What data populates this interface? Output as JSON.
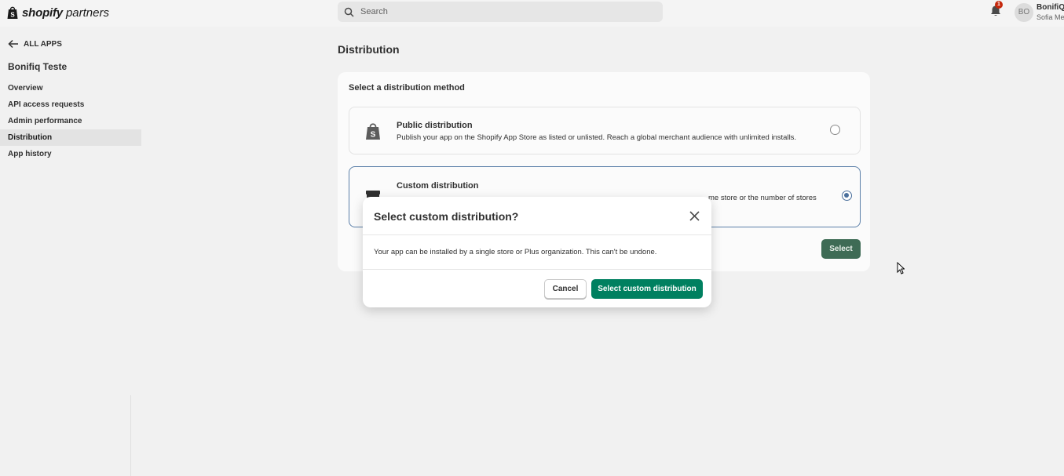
{
  "topbar": {
    "brand": "shopify",
    "brand_sub": "partners",
    "search_placeholder": "Search",
    "notification_count": "1",
    "avatar_initials": "BO",
    "user_name": "BonifiQ",
    "user_sub": "Sofia Mel"
  },
  "sidebar": {
    "back_label": "ALL APPS",
    "app_name": "Bonifiq Teste",
    "items": [
      {
        "label": "Overview"
      },
      {
        "label": "API access requests"
      },
      {
        "label": "Admin performance"
      },
      {
        "label": "Distribution"
      },
      {
        "label": "App history"
      }
    ]
  },
  "main": {
    "title": "Distribution",
    "card_heading": "Select a distribution method",
    "options": [
      {
        "title": "Public distribution",
        "description": "Publish your app on the Shopify App Store as listed or unlisted. Reach a global merchant audience with unlimited installs."
      },
      {
        "title": "Custom distribution",
        "description": "me store or the number of stores"
      }
    ],
    "select_label": "Select"
  },
  "modal": {
    "title": "Select custom distribution?",
    "body": "Your app can be installed by a single store or Plus organization. This can't be undone.",
    "cancel_label": "Cancel",
    "confirm_label": "Select custom distribution"
  },
  "colors": {
    "primary_green": "#008060",
    "selected_border": "#5b7fa8",
    "badge_red": "#c5280c"
  }
}
